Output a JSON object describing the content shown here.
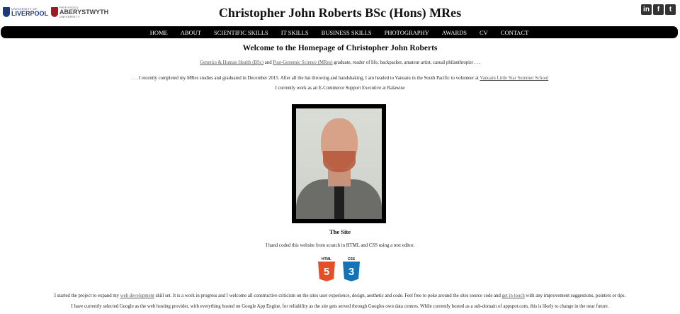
{
  "header": {
    "title": "Christopher John Roberts BSc (Hons) MRes",
    "logos": {
      "liverpool": {
        "small": "UNIVERSITY OF",
        "big": "LIVERPOOL"
      },
      "aberystwyth": {
        "small": "PRIFYSGOL",
        "big": "ABERYSTWYTH",
        "tiny": "UNIVERSITY"
      }
    },
    "social": [
      {
        "name": "linkedin-icon",
        "glyph": "in"
      },
      {
        "name": "facebook-icon",
        "glyph": "f"
      },
      {
        "name": "twitter-icon",
        "glyph": "t"
      }
    ]
  },
  "nav": {
    "items": [
      "HOME",
      "ABOUT",
      "SCIENTIFIC SKILLS",
      "IT SKILLS",
      "BUSINESS SKILLS",
      "PHOTOGRAPHY",
      "AWARDS",
      "CV",
      "CONTACT"
    ]
  },
  "main": {
    "welcome": "Welcome to the Homepage of Christopher John Roberts",
    "intro": {
      "link1": "Genetics & Human Health (BSc)",
      "and": " and ",
      "link2": "Post-Genomic Science (MRes)",
      "rest": " graduate, reader of life, backpacker, amateur artist, casual philanthropist . . ."
    },
    "completed": {
      "text": ". . . I recently completed my MRes studies and graduated in December 2015. After all the hat throwing and handshaking, I am headed to Vanuatu in the South Pacific to volunteer at ",
      "link": "Vanuatu Little Star Summer School"
    },
    "work": "I currently work as an E-Commerce Support Executive at Ralawise",
    "site_heading": "The Site",
    "site_text": "I hand coded this website from scratch in HTML and CSS using a text editor.",
    "tech": [
      {
        "label": "HTML",
        "number": "5"
      },
      {
        "label": "CSS",
        "number": "3"
      }
    ],
    "para1": {
      "a": "I started the project to expand my ",
      "link1": "web development",
      "b": " skill set. It is a work in progress and I welcome all constructive criticism on the sites user experience, design, aesthetic and code. Feel free to poke around the sites source code and ",
      "link2": "get in touch",
      "c": " with any improvement suggestions, pointers or tips."
    },
    "para2": "I have currently selected Google as the web hosting provider, with everything hosted on Google App Engine, for reliability as the site gets served through Googles own data centres. While currently hosted as a sub-domain of appspot.com, this is likely to change in the near future."
  }
}
